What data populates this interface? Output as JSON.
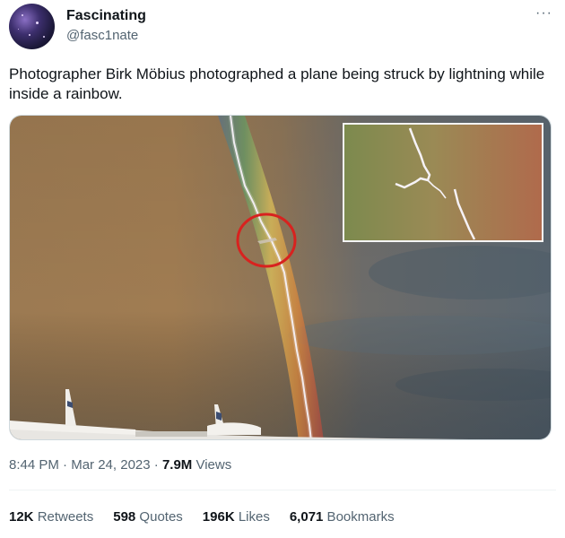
{
  "author": {
    "name": "Fascinating",
    "handle": "@fasc1nate"
  },
  "more_icon": "more-horizontal-icon",
  "tweet": {
    "text": "Photographer Birk Möbius photographed a plane being struck by lightning while inside a rainbow."
  },
  "timestamp": {
    "time": "8:44 PM",
    "sep1": " · ",
    "date": "Mar 24, 2023",
    "sep2": " · ",
    "views_count": "7.9M",
    "views_label": " Views"
  },
  "stats": {
    "retweets_count": "12K",
    "retweets_label": " Retweets",
    "quotes_count": "598",
    "quotes_label": " Quotes",
    "likes_count": "196K",
    "likes_label": " Likes",
    "bookmarks_count": "6,071",
    "bookmarks_label": " Bookmarks"
  },
  "colors": {
    "text_primary": "#0f1419",
    "text_secondary": "#536471",
    "highlight_circle": "#d8221f"
  }
}
